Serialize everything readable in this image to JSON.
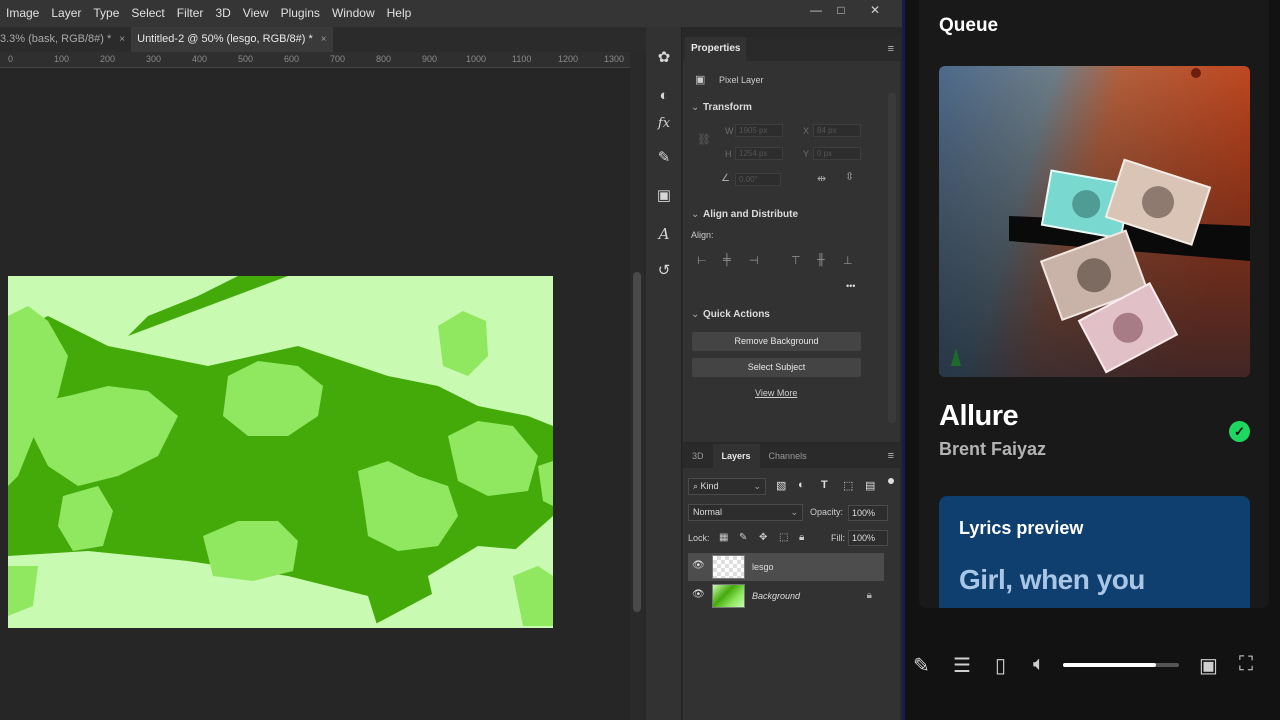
{
  "menubar": {
    "items": [
      "Image",
      "Layer",
      "Type",
      "Select",
      "Filter",
      "3D",
      "View",
      "Plugins",
      "Window",
      "Help"
    ],
    "win_minimize": "—",
    "win_maximize": "□",
    "win_close": "✕"
  },
  "doc_tabs": [
    {
      "label": "3.3% (bask, RGB/8#) *",
      "close": "×"
    },
    {
      "label": "Untitled-2 @ 50% (lesgo, RGB/8#) *",
      "close": "×"
    }
  ],
  "ruler_ticks": [
    "0",
    "100",
    "200",
    "300",
    "400",
    "500",
    "600",
    "700",
    "800",
    "900",
    "1000",
    "1100",
    "1200",
    "1300"
  ],
  "properties": {
    "title": "Properties",
    "layer_type": "Pixel Layer",
    "transform": {
      "title": "Transform",
      "w_label": "W",
      "w_value": "1905 px",
      "x_label": "X",
      "x_value": "84 px",
      "h_label": "H",
      "h_value": "1254 px",
      "y_label": "Y",
      "y_value": "0 px",
      "angle_value": "0.00°"
    },
    "align": {
      "title": "Align and Distribute",
      "align_label": "Align:",
      "more": "•••"
    },
    "quick_actions": {
      "title": "Quick Actions",
      "remove_bg": "Remove Background",
      "select_subject": "Select Subject",
      "view_more": "View More"
    }
  },
  "layers_panel": {
    "tabs": [
      "3D",
      "Layers",
      "Channels"
    ],
    "active_tab": "Layers",
    "kind": "Kind",
    "blend_mode": "Normal",
    "opacity_label": "Opacity:",
    "opacity_value": "100%",
    "lock_label": "Lock:",
    "fill_label": "Fill:",
    "fill_value": "100%",
    "layers": [
      {
        "name": "lesgo",
        "selected": true,
        "italic": false
      },
      {
        "name": "Background",
        "selected": false,
        "italic": true,
        "locked": true
      }
    ]
  },
  "spotify": {
    "queue_title": "Queue",
    "song": "Allure",
    "artist": "Brent Faiyaz",
    "liked_icon": "check-circle-icon",
    "lyrics_header": "Lyrics preview",
    "lyrics_line": "Girl, when you",
    "volume_level": 0.8,
    "accent": "#1ed760",
    "lyrics_bg": "#0e3f6e"
  }
}
